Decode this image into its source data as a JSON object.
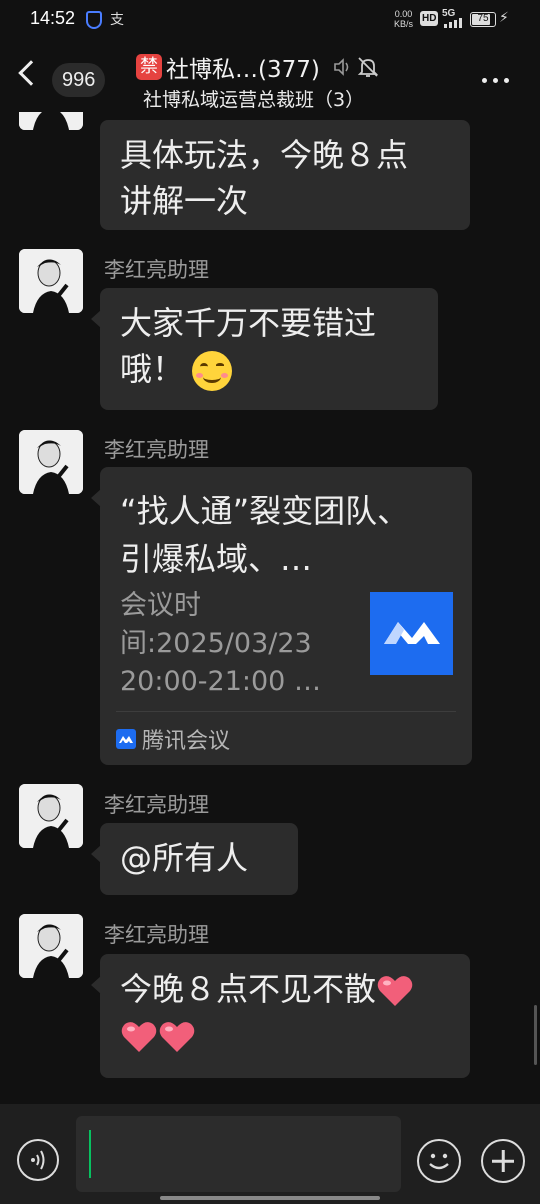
{
  "status_bar": {
    "time": "14:52",
    "app_glyph": "支",
    "net_speed_value": "0.00",
    "net_speed_unit": "KB/s",
    "hd_label": "HD",
    "network": "5G",
    "battery": "75",
    "battery_level": 0.75
  },
  "header": {
    "unread_count": "996",
    "ban_glyph": "禁",
    "title": "社博私…(377)",
    "subtitle": "社博私域运营总裁班（3）"
  },
  "messages": [
    {
      "type": "text",
      "text_line1": "具体玩法，今晚８点",
      "text_line2": "讲解一次"
    },
    {
      "type": "text",
      "sender": "李红亮助理",
      "text_line1": "大家千万不要错过",
      "text_line2": "哦！",
      "emoji": "smiling-face-emoji"
    },
    {
      "type": "card",
      "sender": "李红亮助理",
      "card_title": "“找人通”裂变团队、引爆私域、…",
      "card_desc_line1": "会议时",
      "card_desc_line2": "间:2025/03/23",
      "card_desc_line3": "20:00-21:00 …",
      "card_source": "腾讯会议"
    },
    {
      "type": "text",
      "sender": "李红亮助理",
      "text_line1": "@所有人"
    },
    {
      "type": "text",
      "sender": "李红亮助理",
      "text_line1": "今晚８点不见不散",
      "emoji": "heart-emoji"
    }
  ],
  "input_bar": {
    "placeholder": ""
  },
  "colors": {
    "background": "#111111",
    "bubble": "#2c2c2c",
    "accent_green": "#07c160",
    "meeting_blue": "#1d6cf0",
    "ban_red": "#e64340"
  }
}
